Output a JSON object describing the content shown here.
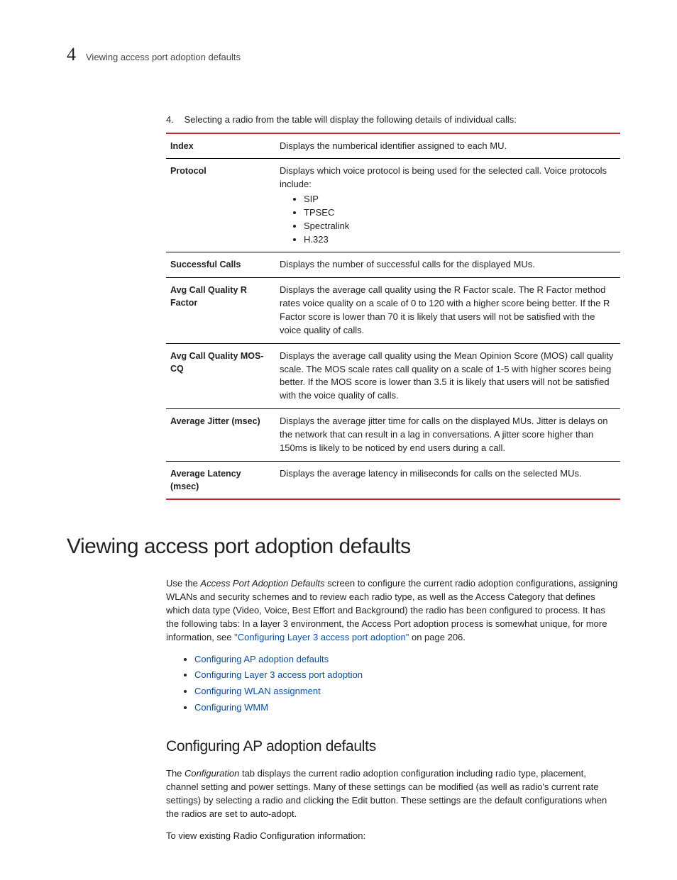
{
  "header": {
    "chapter_number": "4",
    "running_title": "Viewing access port adoption defaults"
  },
  "step": {
    "number": "4.",
    "text": "Selecting a radio from the table will display the following details of individual calls:"
  },
  "table": {
    "rows": [
      {
        "label": "Index",
        "desc": "Displays the numberical identifier assigned to each MU."
      },
      {
        "label": "Protocol",
        "desc_intro": "Displays which voice protocol is being used for the selected call. Voice protocols include:",
        "list": [
          "SIP",
          "TPSEC",
          "Spectralink",
          "H.323"
        ]
      },
      {
        "label": "Successful Calls",
        "desc": "Displays the number of successful calls for the displayed MUs."
      },
      {
        "label": "Avg Call Quality R Factor",
        "desc": "Displays the average call quality using the R Factor scale. The R Factor method rates voice quality on a scale of 0 to 120 with a higher score being better. If the R Factor score is lower than 70 it is likely that users will not be satisfied with the voice quality of calls."
      },
      {
        "label": "Avg Call Quality MOS-CQ",
        "desc": "Displays the average call quality using the Mean Opinion Score (MOS) call quality scale. The MOS scale rates call quality on a scale of 1-5 with higher scores being better. If the MOS score is lower than 3.5 it is likely that users will not be satisfied with the voice quality of calls."
      },
      {
        "label": "Average Jitter (msec)",
        "desc": "Displays the average jitter time for calls on the displayed MUs. Jitter is delays on the network that can result in a lag in conversations. A jitter score higher than 150ms is likely to be noticed by end users during a call."
      },
      {
        "label": "Average Latency (msec)",
        "desc": "Displays the average latency in miliseconds for calls on the selected MUs."
      }
    ]
  },
  "section": {
    "title": "Viewing access port adoption defaults",
    "intro_prefix": "Use the ",
    "intro_italic": "Access Port Adoption Defaults",
    "intro_body": " screen to configure the current radio adoption configurations, assigning WLANs and security schemes and to review each radio type, as well as the Access Category that defines which data type (Video, Voice, Best Effort and Background) the radio has been configured to process. It has the following tabs: In a layer 3 environment, the Access Port adoption process is somewhat unique, for more information, see ",
    "intro_link": "\"Configuring Layer 3 access port adoption\"",
    "intro_suffix": " on page 206.",
    "bullets": [
      "Configuring AP adoption defaults",
      "Configuring Layer 3 access port adoption",
      "Configuring WLAN assignment",
      "Configuring WMM"
    ]
  },
  "subsection": {
    "title": "Configuring AP adoption defaults",
    "p1_prefix": "The ",
    "p1_italic": "Configuration",
    "p1_body": " tab displays the current radio adoption configuration including radio type, placement, channel setting and power settings. Many of these settings can be modified (as well as radio's current rate settings) by selecting a radio and clicking the Edit button. These settings are the default configurations when the radios are set to auto-adopt.",
    "p2": "To view existing Radio Configuration information:"
  }
}
